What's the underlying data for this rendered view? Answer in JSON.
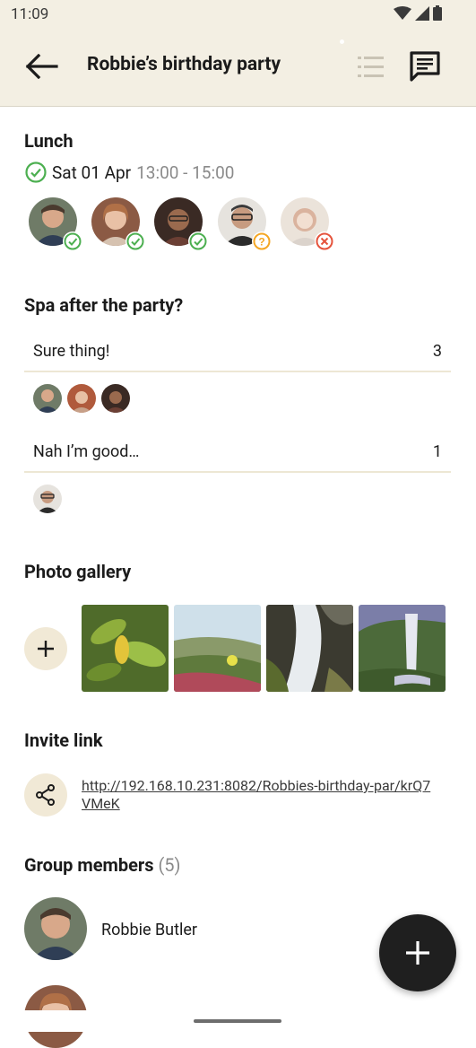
{
  "status": {
    "time": "11:09"
  },
  "header": {
    "title": "Robbie’s birthday party"
  },
  "event": {
    "title": "Lunch",
    "date": "Sat 01 Apr",
    "time": "13:00 - 15:00",
    "attendees": [
      {
        "status": "accepted"
      },
      {
        "status": "accepted"
      },
      {
        "status": "accepted"
      },
      {
        "status": "maybe"
      },
      {
        "status": "declined"
      }
    ]
  },
  "poll": {
    "title": "Spa after the party?",
    "options": [
      {
        "label": "Sure thing!",
        "count": "3"
      },
      {
        "label": "Nah I’m good…",
        "count": "1"
      }
    ]
  },
  "gallery": {
    "title": "Photo gallery"
  },
  "invite": {
    "title": "Invite link",
    "url": "http://192.168.10.231:8082/Robbies-birthday-par/krQ7VMeK"
  },
  "members": {
    "title": "Group members",
    "count": "(5)",
    "list": [
      {
        "name": "Robbie Butler"
      },
      {
        "name": ""
      }
    ]
  },
  "colors": {
    "accent_bg": "#f3efe3",
    "accepted": "#4caf50",
    "maybe": "#f5a623",
    "declined": "#e5533c"
  }
}
